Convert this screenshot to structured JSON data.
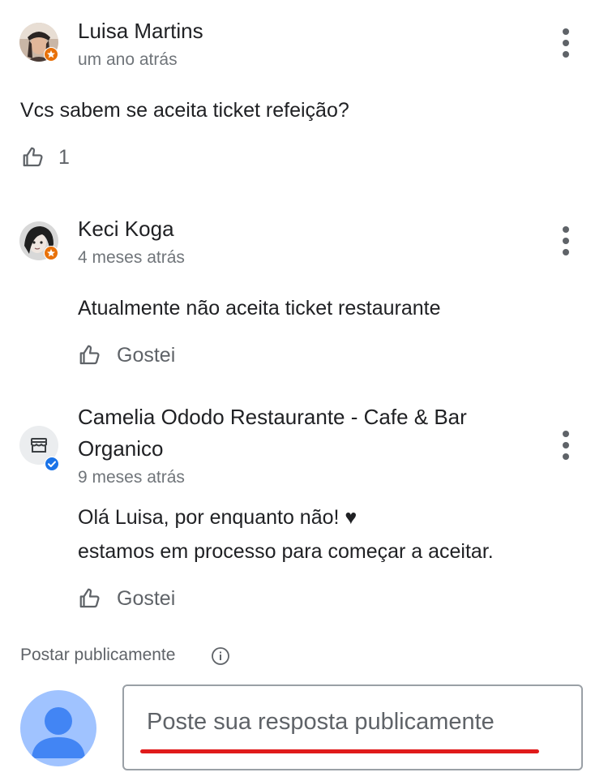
{
  "question": {
    "author": "Luisa Martins",
    "time": "um ano atrás",
    "text": "Vcs sabem se aceita ticket refeição?",
    "like_count": "1"
  },
  "answers": [
    {
      "author": "Keci Koga",
      "time": "4 meses atrás",
      "text": "Atualmente não aceita ticket restaurante",
      "like_label": "Gostei"
    },
    {
      "author_line1": "Camelia Ododo Restaurante - Cafe & Bar",
      "author_line2": "Organico",
      "time": "9 meses atrás",
      "text_line1": "Olá Luisa, por enquanto não! ♥",
      "text_line2": "estamos em processo para começar a aceitar.",
      "like_label": "Gostei",
      "verified": true
    }
  ],
  "composer": {
    "label": "Postar publicamente",
    "placeholder": "Poste sua resposta publicamente"
  },
  "colors": {
    "local_guide_badge": "#e8710a",
    "verified_badge": "#1a73e8",
    "user_avatar_bg": "#a0c3ff",
    "user_avatar_fg": "#4285f4",
    "underline": "#e01b1b"
  }
}
